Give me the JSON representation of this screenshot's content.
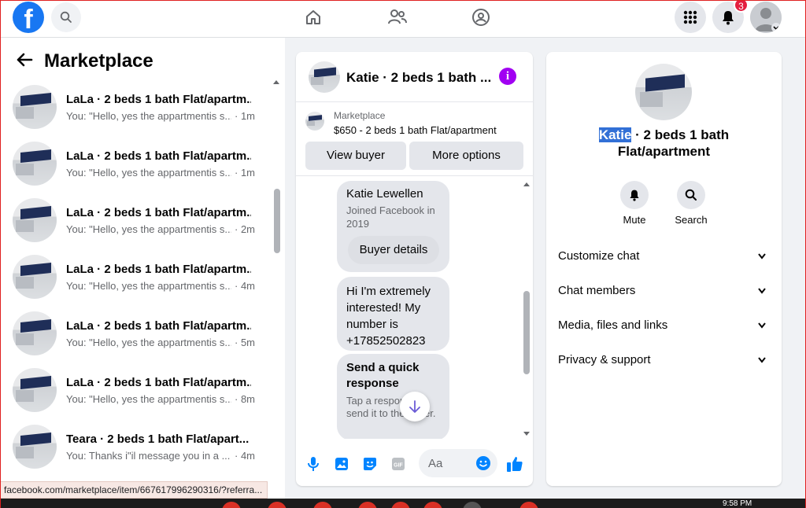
{
  "topbar": {
    "logo_letter": "f",
    "notifications_count": "3"
  },
  "marketplace": {
    "title": "Marketplace",
    "conversations": [
      {
        "title": "LaLa · 2 beds 1 bath Flat/apartm...",
        "snippet": "You: \"Hello, yes the appartmentis s...",
        "time": "· 1m"
      },
      {
        "title": "LaLa · 2 beds 1 bath Flat/apartm...",
        "snippet": "You: \"Hello, yes the appartmentis s...",
        "time": "· 1m"
      },
      {
        "title": "LaLa · 2 beds 1 bath Flat/apartm...",
        "snippet": "You: \"Hello, yes the appartmentis s...",
        "time": "· 2m"
      },
      {
        "title": "LaLa · 2 beds 1 bath Flat/apartm...",
        "snippet": "You: \"Hello, yes the appartmentis s...",
        "time": "· 4m"
      },
      {
        "title": "LaLa · 2 beds 1 bath Flat/apartm...",
        "snippet": "You: \"Hello, yes the appartmentis s...",
        "time": "· 5m"
      },
      {
        "title": "LaLa · 2 beds 1 bath Flat/apartm...",
        "snippet": "You: \"Hello, yes the appartmentis s...",
        "time": "· 8m"
      },
      {
        "title": "Teara · 2 beds 1 bath Flat/apart...",
        "snippet": "You: Thanks i\"il message you in a ...",
        "time": "· 4m"
      }
    ]
  },
  "chat": {
    "title": "Katie · 2 beds 1 bath ...",
    "listing_source": "Marketplace",
    "listing_price": "$650 - 2 beds 1 bath Flat/apartment",
    "view_buyer": "View buyer",
    "more_options": "More options",
    "profile_name": "Katie Lewellen",
    "profile_sub": "Joined Facebook in 2019",
    "buyer_details": "Buyer details",
    "message": "Hi I'm extremely interested! My number is +17852502823",
    "quick_title": "Send a quick response",
    "quick_sub": "Tap a response to send it to the buyer.",
    "composer_placeholder": "Aa"
  },
  "info": {
    "title_highlight": "Katie",
    "title_rest": " · 2 beds 1 bath Flat/apartment",
    "mute": "Mute",
    "search": "Search",
    "sections": [
      "Customize chat",
      "Chat members",
      "Media, files and links",
      "Privacy & support"
    ]
  },
  "statusbar": {
    "url": "facebook.com/marketplace/item/667617996290316/?referra..."
  },
  "taskbar": {
    "time": "9:58 PM"
  },
  "colors": {
    "brand": "#1877f2",
    "info_purple": "#a100f2",
    "messenger_blue": "#0084ff",
    "badge_red": "#e41e3f"
  }
}
